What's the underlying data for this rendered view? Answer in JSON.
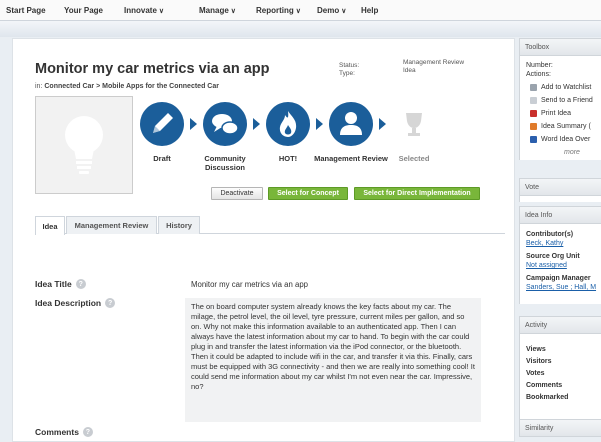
{
  "nav": {
    "items": [
      {
        "label": "Start Page",
        "dropdown": false
      },
      {
        "label": "Your Page",
        "dropdown": false
      },
      {
        "label": "Innovate",
        "dropdown": true
      },
      {
        "label": "Manage",
        "dropdown": true
      },
      {
        "label": "Reporting",
        "dropdown": true
      },
      {
        "label": "Demo",
        "dropdown": true
      },
      {
        "label": "Help",
        "dropdown": false
      }
    ],
    "chevron": "∨"
  },
  "idea": {
    "title": "Monitor my car metrics via an app",
    "status_label": "Status:",
    "type_label": "Type:",
    "status_value": "Management Review",
    "type_value": "Idea",
    "breadcrumb_prefix": "in:",
    "breadcrumb_1": "Connected Car",
    "breadcrumb_sep": ">",
    "breadcrumb_2": "Mobile Apps for the Connected Car"
  },
  "stages": [
    {
      "label": "Draft",
      "icon": "pencil-icon",
      "color": "#1b5e9a"
    },
    {
      "label": "Community Discussion",
      "icon": "chat-bubbles-icon",
      "color": "#1b5e9a"
    },
    {
      "label": "HOT!",
      "icon": "flame-icon",
      "color": "#1b5e9a"
    },
    {
      "label": "Management Review",
      "icon": "manager-icon",
      "color": "#1b5e9a"
    },
    {
      "label": "Selected",
      "icon": "trophy-icon",
      "color": "#d9d9d9"
    }
  ],
  "actions": {
    "deactivate": "Deactivate",
    "select_concept": "Select for Concept",
    "select_direct": "Select for Direct Implementation"
  },
  "tabs": [
    {
      "label": "Idea",
      "active": true
    },
    {
      "label": "Management Review",
      "active": false
    },
    {
      "label": "History",
      "active": false
    }
  ],
  "fields": {
    "title_label": "Idea Title",
    "title_value": "Monitor my car metrics via an app",
    "description_label": "Idea Description",
    "description_value": "The on board computer system already knows the key facts about my car. The milage, the petrol level, the oil level, tyre pressure, current miles per gallon, and so on. Why not make this information available to an authenticated app. Then I can always have the latest information about my car to hand. To begin with the car could plug in and transfer the latest information via the iPod connector, or the bluetooth. Then it could be adapted to include wifi in the car, and transfer it via this. Finally, cars must be equipped with 3G connectivity - and then we are really into something cool! It could send me information about my car whilst I'm not even near the car. Impressive, no?",
    "comments_label": "Comments",
    "help_glyph": "?"
  },
  "sidebar": {
    "toolbox_title": "Toolbox",
    "number_label": "Number:",
    "actions_label": "Actions:",
    "actions": [
      {
        "label": "Add to Watchlist",
        "icon": "watchlist-icon",
        "color": "#9aa3ad"
      },
      {
        "label": "Send to a Friend",
        "icon": "mail-icon",
        "color": "#c9ced4"
      },
      {
        "label": "Print Idea",
        "icon": "pdf-icon",
        "color": "#c9302c"
      },
      {
        "label": "Idea Summary (",
        "icon": "powerpoint-icon",
        "color": "#e07b2b"
      },
      {
        "label": "Word Idea Over",
        "icon": "word-icon",
        "color": "#2b5fad"
      }
    ],
    "more": "more",
    "vote_title": "Vote",
    "idea_info_title": "Idea Info",
    "contributors_label": "Contributor(s)",
    "contributors_value": "Beck, Kathy",
    "source_org_label": "Source Org Unit",
    "source_org_value": "Not assigned",
    "campaign_label": "Campaign Manager",
    "campaign_value": "Sanders, Sue ; Hall, M",
    "activity_title": "Activity",
    "activity_items": [
      "Views",
      "Visitors",
      "Votes",
      "Comments",
      "Bookmarked"
    ],
    "similarity_title": "Similarity"
  }
}
